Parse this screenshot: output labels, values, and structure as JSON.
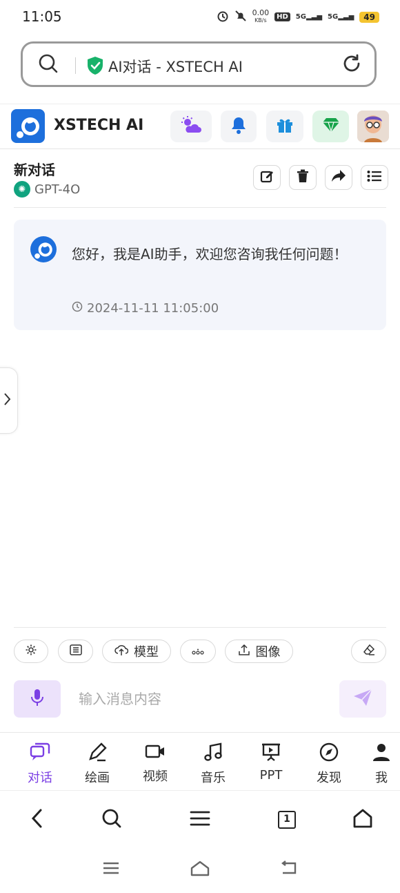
{
  "status": {
    "time": "11:05",
    "net_speed_top": "0.00",
    "net_speed_unit": "KB/s",
    "hd": "HD",
    "sig1": "5G",
    "sig2": "5G",
    "battery": "49"
  },
  "browser": {
    "url_text": "AI对话 - XSTECH AI"
  },
  "app": {
    "brand": "XSTECH AI"
  },
  "conversation": {
    "title": "新对话",
    "model": "GPT-4O"
  },
  "message": {
    "text": "您好，我是AI助手，欢迎您咨询我任何问题！",
    "timestamp": "2024-11-11 11:05:00"
  },
  "tools": {
    "model_label": "模型",
    "image_label": "图像"
  },
  "input": {
    "placeholder": "输入消息内容"
  },
  "nav": [
    {
      "label": "对话"
    },
    {
      "label": "绘画"
    },
    {
      "label": "视频"
    },
    {
      "label": "音乐"
    },
    {
      "label": "PPT"
    },
    {
      "label": "发现"
    },
    {
      "label": "我"
    }
  ],
  "browser_toolbar": {
    "tabs_count": "1"
  },
  "colors": {
    "accent": "#7b3fe4",
    "brand_blue": "#1d6fdc",
    "gpt_green": "#10a37f"
  }
}
